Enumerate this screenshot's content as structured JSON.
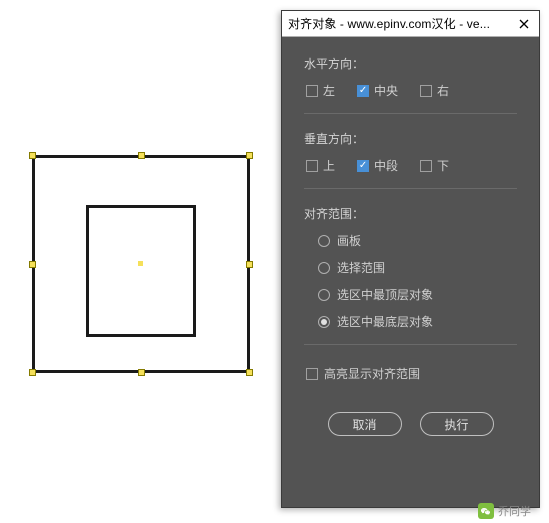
{
  "dialog": {
    "title": "对齐对象 - www.epinv.com汉化 - ve...",
    "horizontal": {
      "label": "水平方向：",
      "options": [
        {
          "label": "左",
          "checked": false
        },
        {
          "label": "中央",
          "checked": true
        },
        {
          "label": "右",
          "checked": false
        }
      ]
    },
    "vertical": {
      "label": "垂直方向：",
      "options": [
        {
          "label": "上",
          "checked": false
        },
        {
          "label": "中段",
          "checked": true
        },
        {
          "label": "下",
          "checked": false
        }
      ]
    },
    "scope": {
      "label": "对齐范围：",
      "options": [
        {
          "label": "画板",
          "selected": false
        },
        {
          "label": "选择范围",
          "selected": false
        },
        {
          "label": "选区中最顶层对象",
          "selected": false
        },
        {
          "label": "选区中最底层对象",
          "selected": true
        }
      ]
    },
    "highlight": {
      "label": "高亮显示对齐范围",
      "checked": false
    },
    "buttons": {
      "cancel": "取消",
      "execute": "执行"
    }
  },
  "credit": {
    "name": "乔同学"
  }
}
